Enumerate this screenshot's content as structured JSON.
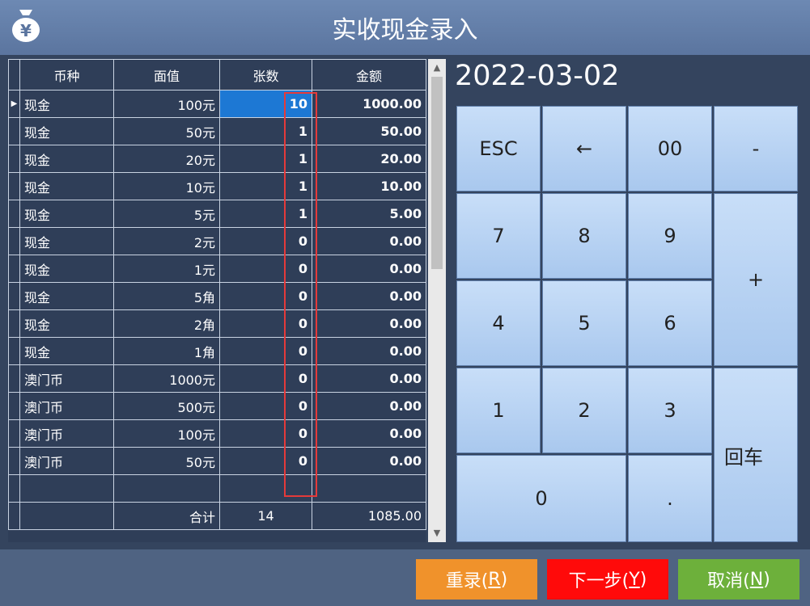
{
  "window": {
    "title": "实收现金录入"
  },
  "table": {
    "headers": [
      "币种",
      "面值",
      "张数",
      "金额"
    ],
    "rows": [
      {
        "currency": "现金",
        "denomination": "100元",
        "count": "10",
        "amount": "1000.00"
      },
      {
        "currency": "现金",
        "denomination": "50元",
        "count": "1",
        "amount": "50.00"
      },
      {
        "currency": "现金",
        "denomination": "20元",
        "count": "1",
        "amount": "20.00"
      },
      {
        "currency": "现金",
        "denomination": "10元",
        "count": "1",
        "amount": "10.00"
      },
      {
        "currency": "现金",
        "denomination": "5元",
        "count": "1",
        "amount": "5.00"
      },
      {
        "currency": "现金",
        "denomination": "2元",
        "count": "0",
        "amount": "0.00"
      },
      {
        "currency": "现金",
        "denomination": "1元",
        "count": "0",
        "amount": "0.00"
      },
      {
        "currency": "现金",
        "denomination": "5角",
        "count": "0",
        "amount": "0.00"
      },
      {
        "currency": "现金",
        "denomination": "2角",
        "count": "0",
        "amount": "0.00"
      },
      {
        "currency": "现金",
        "denomination": "1角",
        "count": "0",
        "amount": "0.00"
      },
      {
        "currency": "澳门币",
        "denomination": "1000元",
        "count": "0",
        "amount": "0.00"
      },
      {
        "currency": "澳门币",
        "denomination": "500元",
        "count": "0",
        "amount": "0.00"
      },
      {
        "currency": "澳门币",
        "denomination": "100元",
        "count": "0",
        "amount": "0.00"
      },
      {
        "currency": "澳门币",
        "denomination": "50元",
        "count": "0",
        "amount": "0.00"
      }
    ],
    "footer": {
      "label": "合计",
      "count": "14",
      "amount": "1085.00"
    },
    "selected_row": 0
  },
  "date": "2022-03-02",
  "keypad": {
    "esc": "ESC",
    "backspace": "←",
    "double_zero": "00",
    "minus": "-",
    "seven": "7",
    "eight": "8",
    "nine": "9",
    "plus": "+",
    "four": "4",
    "five": "5",
    "six": "6",
    "one": "1",
    "two": "2",
    "three": "3",
    "enter": "回车",
    "zero": "0",
    "dot": "."
  },
  "buttons": {
    "reset": {
      "label": "重录(",
      "key": "R",
      "end": ")",
      "color": "#f0922b"
    },
    "next": {
      "label": "下一步(",
      "key": "Y",
      "end": ")",
      "color": "#ff0a0a"
    },
    "cancel": {
      "label": "取消(",
      "key": "N",
      "end": ")",
      "color": "#6db03b"
    }
  },
  "icons": {
    "window": "money-bag-icon"
  }
}
